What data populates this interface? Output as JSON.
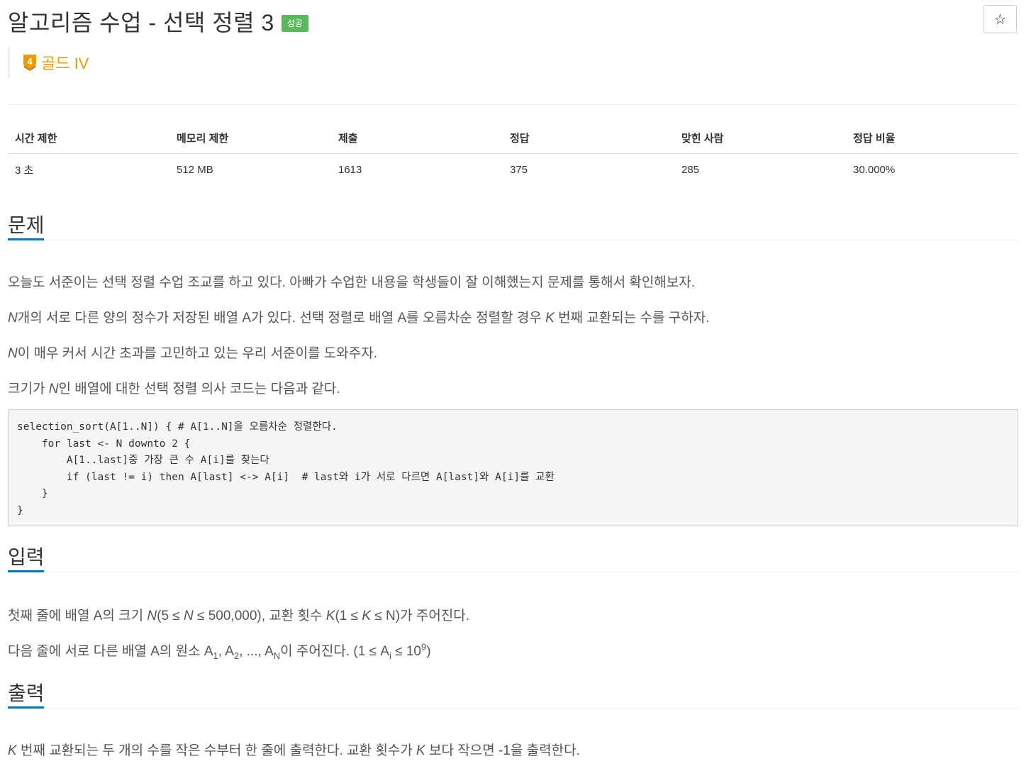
{
  "header": {
    "title": "알고리즘 수업 - 선택 정렬 3",
    "status_badge": "성공",
    "star_icon": "☆",
    "tier_number": "4",
    "tier_label": "골드 IV",
    "tier_color": "#ec9a00"
  },
  "stats": {
    "headers": [
      "시간 제한",
      "메모리 제한",
      "제출",
      "정답",
      "맞힌 사람",
      "정답 비율"
    ],
    "values": [
      "3 초",
      "512 MB",
      "1613",
      "375",
      "285",
      "30.000%"
    ]
  },
  "problem": {
    "title": "문제",
    "p1": "오늘도 서준이는 선택 정렬 수업 조교를 하고 있다. 아빠가 수업한 내용을 학생들이 잘 이해했는지 문제를 통해서 확인해보자.",
    "p2_var": "N",
    "p2_mid": "개의 서로 다른 양의 정수가 저장된 배열 A가 있다. 선택 정렬로 배열 A를 오름차순 정렬할 경우 ",
    "p2_var2": "K",
    "p2_tail": " 번째 교환되는 수를 구하자.",
    "p3_var": "N",
    "p3_tail": "이 매우 커서 시간 초과를 고민하고 있는 우리 서준이를 도와주자.",
    "p4_head": "크기가 ",
    "p4_var": "N",
    "p4_tail": "인 배열에 대한 선택 정렬 의사 코드는 다음과 같다.",
    "code": "selection_sort(A[1..N]) { # A[1..N]을 오름차순 정렬한다.\n    for last <- N downto 2 {\n        A[1..last]중 가장 큰 수 A[i]를 찾는다\n        if (last != i) then A[last] <-> A[i]  # last와 i가 서로 다르면 A[last]와 A[i]를 교환\n    }\n}"
  },
  "input": {
    "title": "입력",
    "l1_head": "첫째 줄에 배열 A의 크기 ",
    "l1_var": "N",
    "l1_paren": "(5 ≤ ",
    "l1_var2": "N",
    "l1_mid": " ≤ 500,000), 교환 횟수 ",
    "l1_var3": "K",
    "l1_paren2": "(1 ≤ ",
    "l1_var4": "K",
    "l1_tail": " ≤ N)가 주어진다.",
    "l2_head": "다음 줄에 서로 다른 배열 A의 원소 A",
    "l2_sub1": "1",
    "l2_sep1": ", A",
    "l2_sub2": "2",
    "l2_sep2": ", ..., A",
    "l2_subN": "N",
    "l2_mid": "이 주어진다. (1 ≤ A",
    "l2_subi": "i",
    "l2_mid2": " ≤ 10",
    "l2_sup": "9",
    "l2_tail": ")"
  },
  "output": {
    "title": "출력",
    "var": "K",
    "text_a": " 번째 교환되는 두 개의 수를 작은 수부터 한 줄에 출력한다. 교환 횟수가 ",
    "var2": "K",
    "text_b": " 보다 작으면 -1을 출력한다."
  }
}
